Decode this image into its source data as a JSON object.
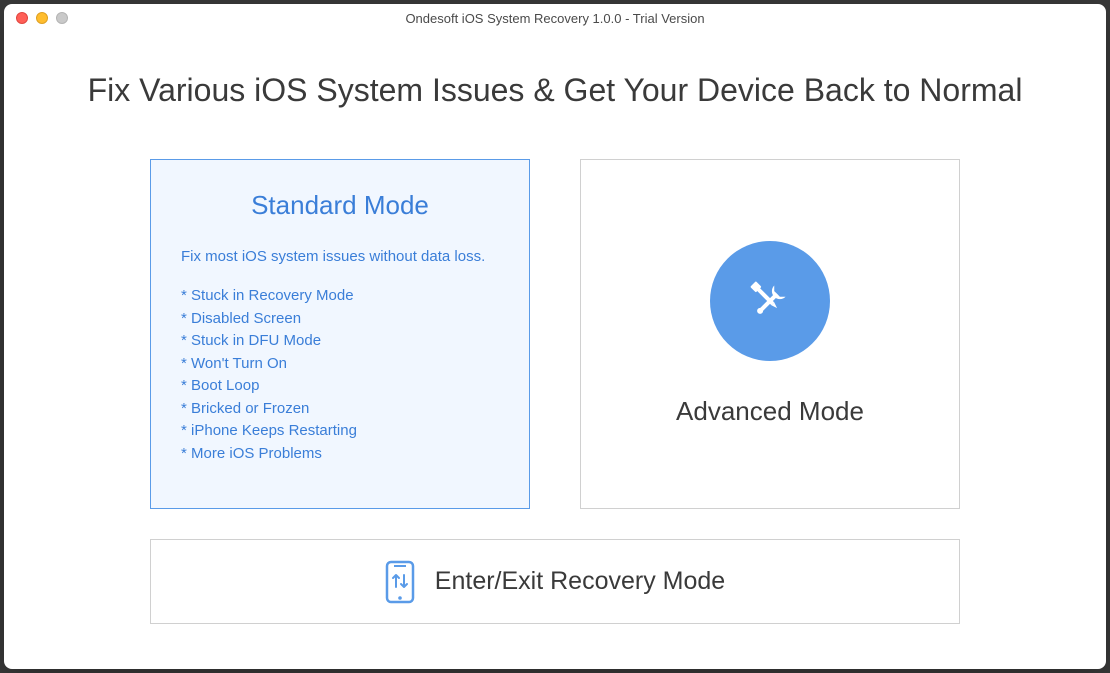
{
  "window": {
    "title": "Ondesoft iOS System Recovery 1.0.0 - Trial Version"
  },
  "heading": "Fix Various iOS System Issues & Get Your Device Back to Normal",
  "standard": {
    "title": "Standard Mode",
    "description": "Fix most iOS system issues without data loss.",
    "items": [
      "Stuck in Recovery Mode",
      "Disabled Screen",
      "Stuck in DFU Mode",
      "Won't Turn On",
      "Boot Loop",
      "Bricked or Frozen",
      "iPhone Keeps Restarting",
      "More iOS Problems"
    ]
  },
  "advanced": {
    "title": "Advanced Mode"
  },
  "recovery": {
    "label": "Enter/Exit Recovery Mode"
  },
  "colors": {
    "accent": "#5a9be8",
    "selected_bg": "#f1f7ff"
  }
}
